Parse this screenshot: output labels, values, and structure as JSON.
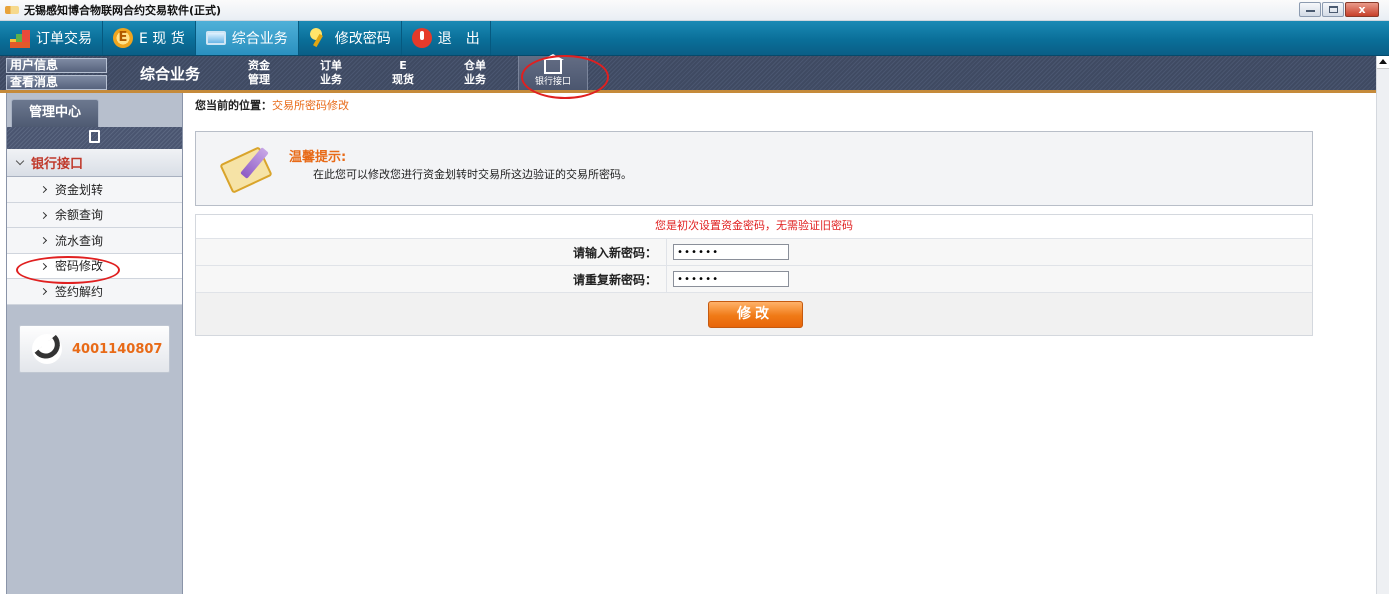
{
  "window": {
    "title": "无锡感知博合物联网合约交易软件(正式)",
    "close_label": "x"
  },
  "main_nav": [
    {
      "label": "订单交易",
      "icon": "chart-icon",
      "active": false
    },
    {
      "label": "E 现 货",
      "icon": "e-coin-icon",
      "active": false
    },
    {
      "label": "综合业务",
      "icon": "monitor-icon",
      "active": true
    },
    {
      "label": "修改密码",
      "icon": "key-icon",
      "active": false
    },
    {
      "label": "退　出",
      "icon": "power-icon",
      "active": false
    }
  ],
  "sub_nav": {
    "user_info": "用户信息",
    "view_messages": "查看消息",
    "section_title": "综合业务",
    "items": [
      {
        "line1": "资金",
        "line2": "管理"
      },
      {
        "line1": "订单",
        "line2": "业务"
      },
      {
        "line1": "E",
        "line2": "现货"
      },
      {
        "line1": "仓单",
        "line2": "业务"
      }
    ],
    "bank_interface": "银行接口"
  },
  "sidebar": {
    "tab": "管理中心",
    "section": "银行接口",
    "items": [
      "资金划转",
      "余额查询",
      "流水查询",
      "密码修改",
      "签约解约"
    ],
    "active_index": 3,
    "phone": "4001140807"
  },
  "content": {
    "location_label": "您当前的位置：",
    "location_value": "交易所密码修改",
    "tip_title": "温馨提示:",
    "tip_text": "在此您可以修改您进行资金划转时交易所这边验证的交易所密码。",
    "notice": "您是初次设置资金密码，无需验证旧密码",
    "new_password_label": "请输入新密码：",
    "new_password_value": "••••••",
    "confirm_password_label": "请重复新密码：",
    "confirm_password_value": "••••••",
    "submit_label": "修改"
  },
  "colors": {
    "main_nav_bg": "#0a6f99",
    "sub_nav_bg": "#4a5670",
    "accent_orange": "#e86a17",
    "alert_red": "#e02020"
  }
}
